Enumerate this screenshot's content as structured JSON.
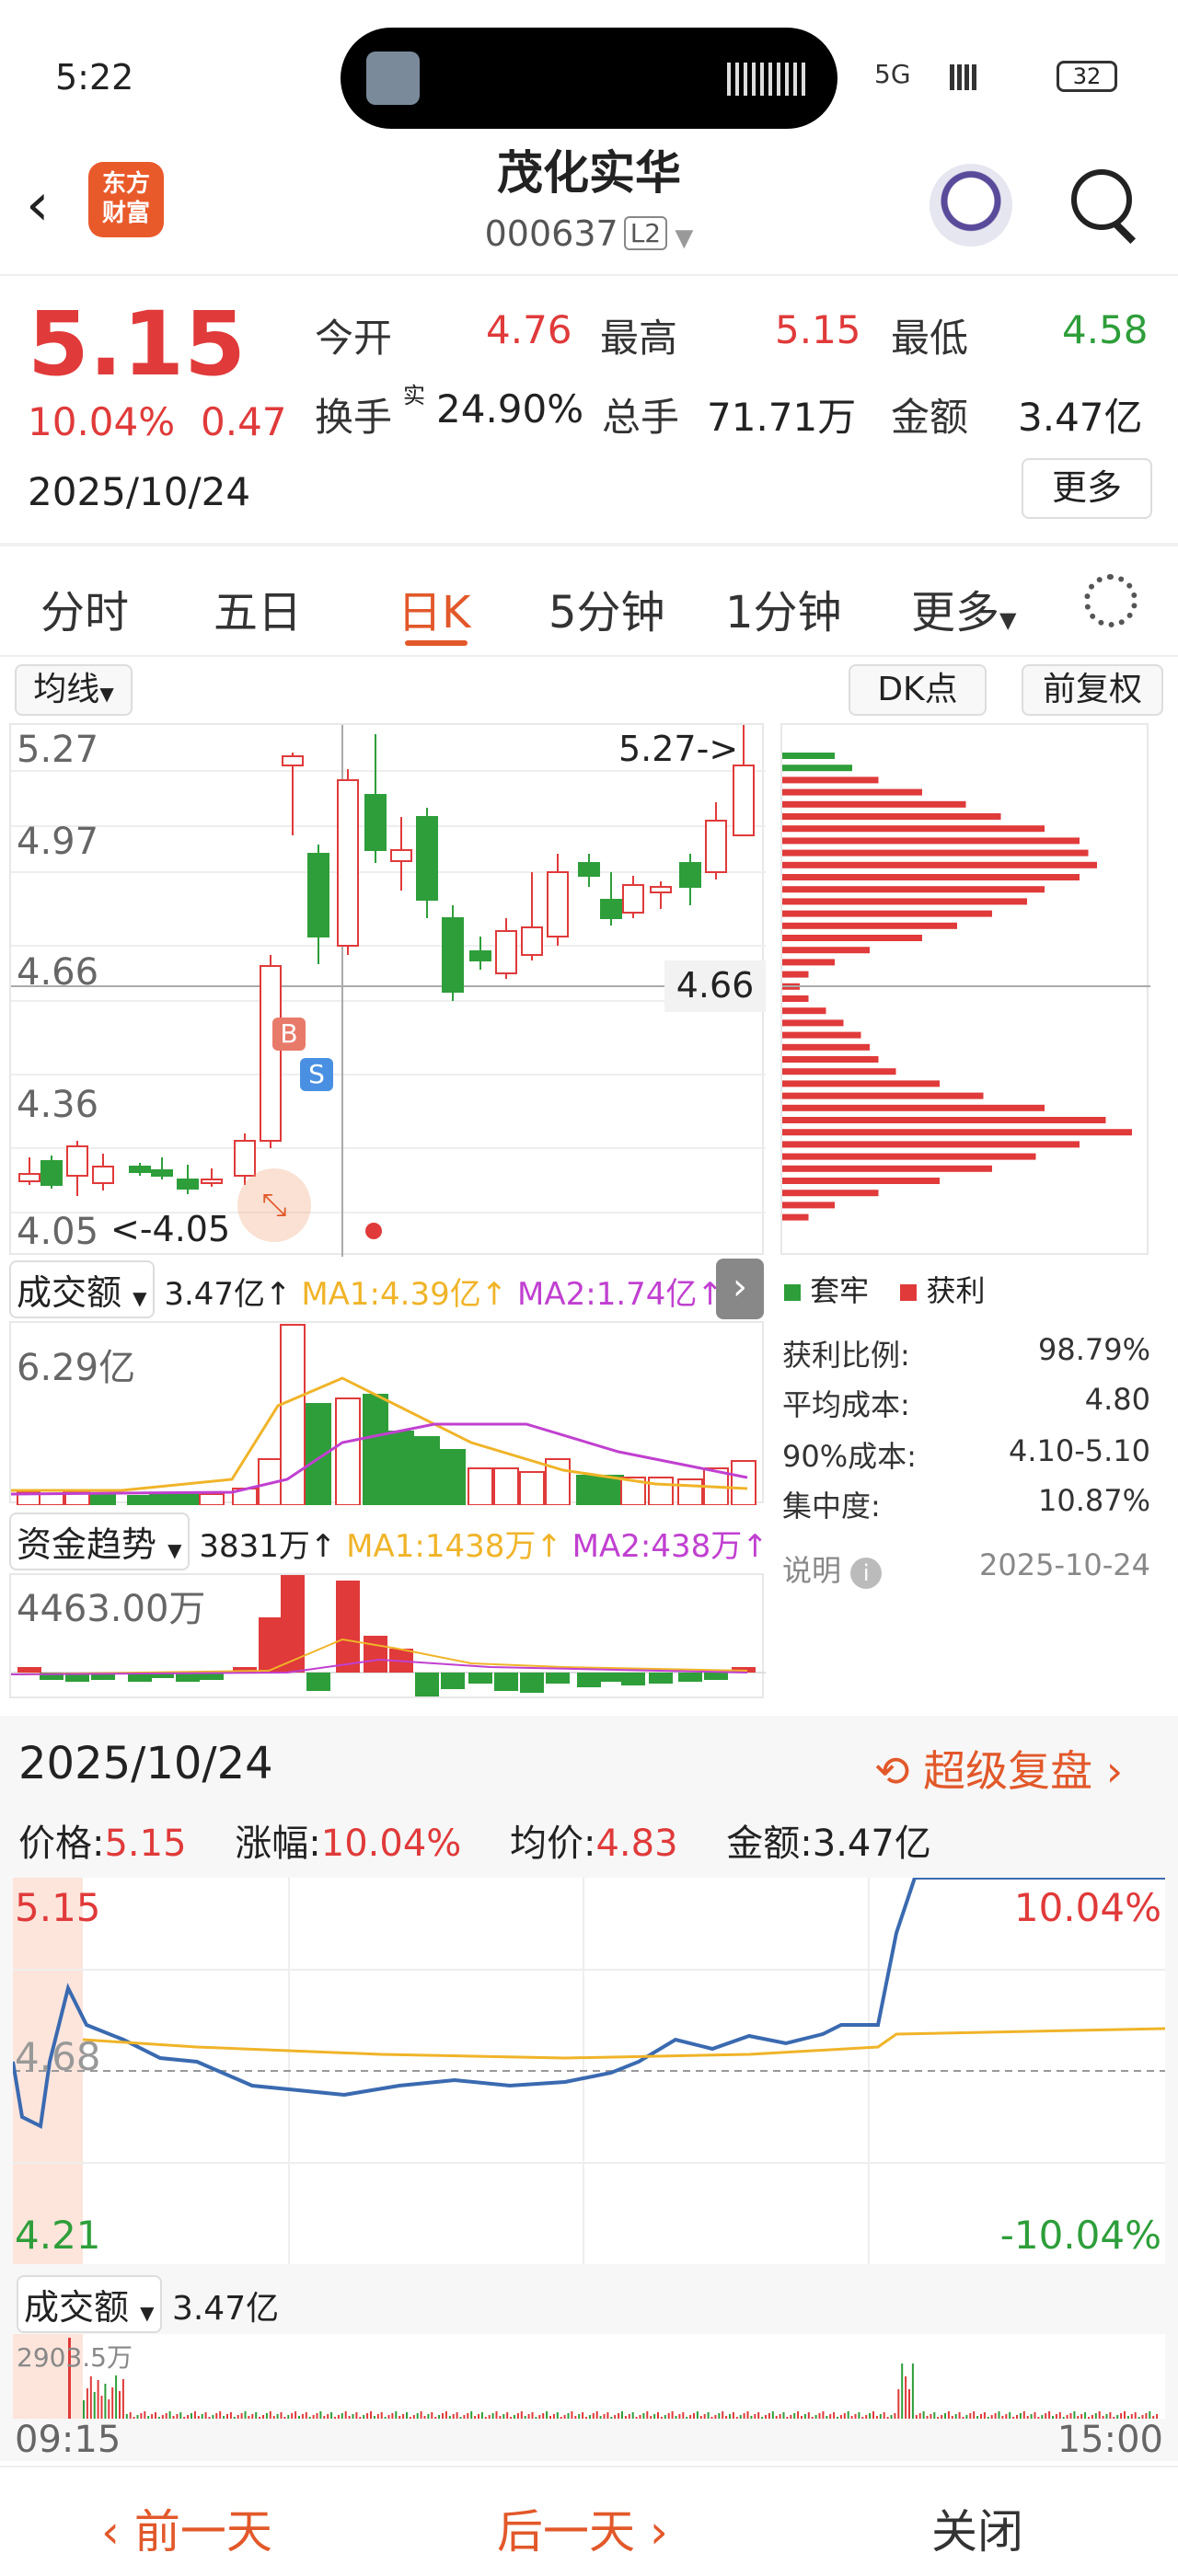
{
  "status": {
    "time": "5:22",
    "battery": "32",
    "net": "5G"
  },
  "header": {
    "title": "茂化实华",
    "code": "000637",
    "level": "L2",
    "logo_text": "东方\n财富"
  },
  "quote": {
    "price": "5.15",
    "change_pct": "10.04%",
    "change_amt": "0.47",
    "date": "2025/10/24",
    "open_label": "今开",
    "open": "4.76",
    "high_label": "最高",
    "high": "5.15",
    "low_label": "最低",
    "low": "4.58",
    "turnover_label": "换手",
    "turnover_sup": "实",
    "turnover": "24.90%",
    "vol_label": "总手",
    "vol": "71.71万",
    "amt_label": "金额",
    "amt": "3.47亿",
    "more": "更多"
  },
  "tabs": [
    "分时",
    "五日",
    "日K",
    "5分钟",
    "1分钟",
    "更多"
  ],
  "active_tab": "日K",
  "kline": {
    "ma_label": "均线",
    "dk_label": "DK点",
    "adj_label": "前复权",
    "yticks": [
      "5.27",
      "4.97",
      "4.66",
      "4.36",
      "4.05"
    ],
    "high_marker": "5.27->",
    "low_marker": "<-4.05",
    "cross_label": "4.66",
    "buy": "B",
    "sell": "S"
  },
  "chip": {
    "legend_trapped": "套牢",
    "legend_profit": "获利",
    "rows": [
      [
        "获利比例:",
        "98.79%"
      ],
      [
        "平均成本:",
        "4.80"
      ],
      [
        "90%成本:",
        "4.10-5.10"
      ],
      [
        "集中度:",
        "10.87%"
      ]
    ],
    "note": "说明",
    "date": "2025-10-24"
  },
  "volume": {
    "label": "成交额",
    "value": "3.47亿↑",
    "ma1": "MA1:4.39亿↑",
    "ma2": "MA2:1.74亿↑",
    "ymax": "6.29亿"
  },
  "fund": {
    "label": "资金趋势",
    "value": "3831万↑",
    "ma1": "MA1:1438万↑",
    "ma2": "MA2:438万↑",
    "ymax": "4463.00万"
  },
  "intraday": {
    "date": "2025/10/24",
    "replay": "超级复盘",
    "price_label": "价格:",
    "price": "5.15",
    "pct_label": "涨幅:",
    "pct": "10.04%",
    "avg_label": "均价:",
    "avg": "4.83",
    "amt_label": "金额:",
    "amt": "3.47亿",
    "ytop": "5.15",
    "ymid": "4.68",
    "ybot": "4.21",
    "pct_top": "10.04%",
    "pct_bot": "-10.04%",
    "vol_label": "成交额",
    "vol_value": "3.47亿",
    "vol_max": "2903.5万",
    "t_start": "09:15",
    "t_end": "15:00"
  },
  "bottom_nav": {
    "prev": "前一天",
    "next": "后一天",
    "close": "关闭"
  },
  "colors": {
    "up": "#e03a3a",
    "down": "#2e9e3a",
    "accent": "#e2582a",
    "ma1": "#f0b429",
    "ma2": "#c040d0"
  }
}
